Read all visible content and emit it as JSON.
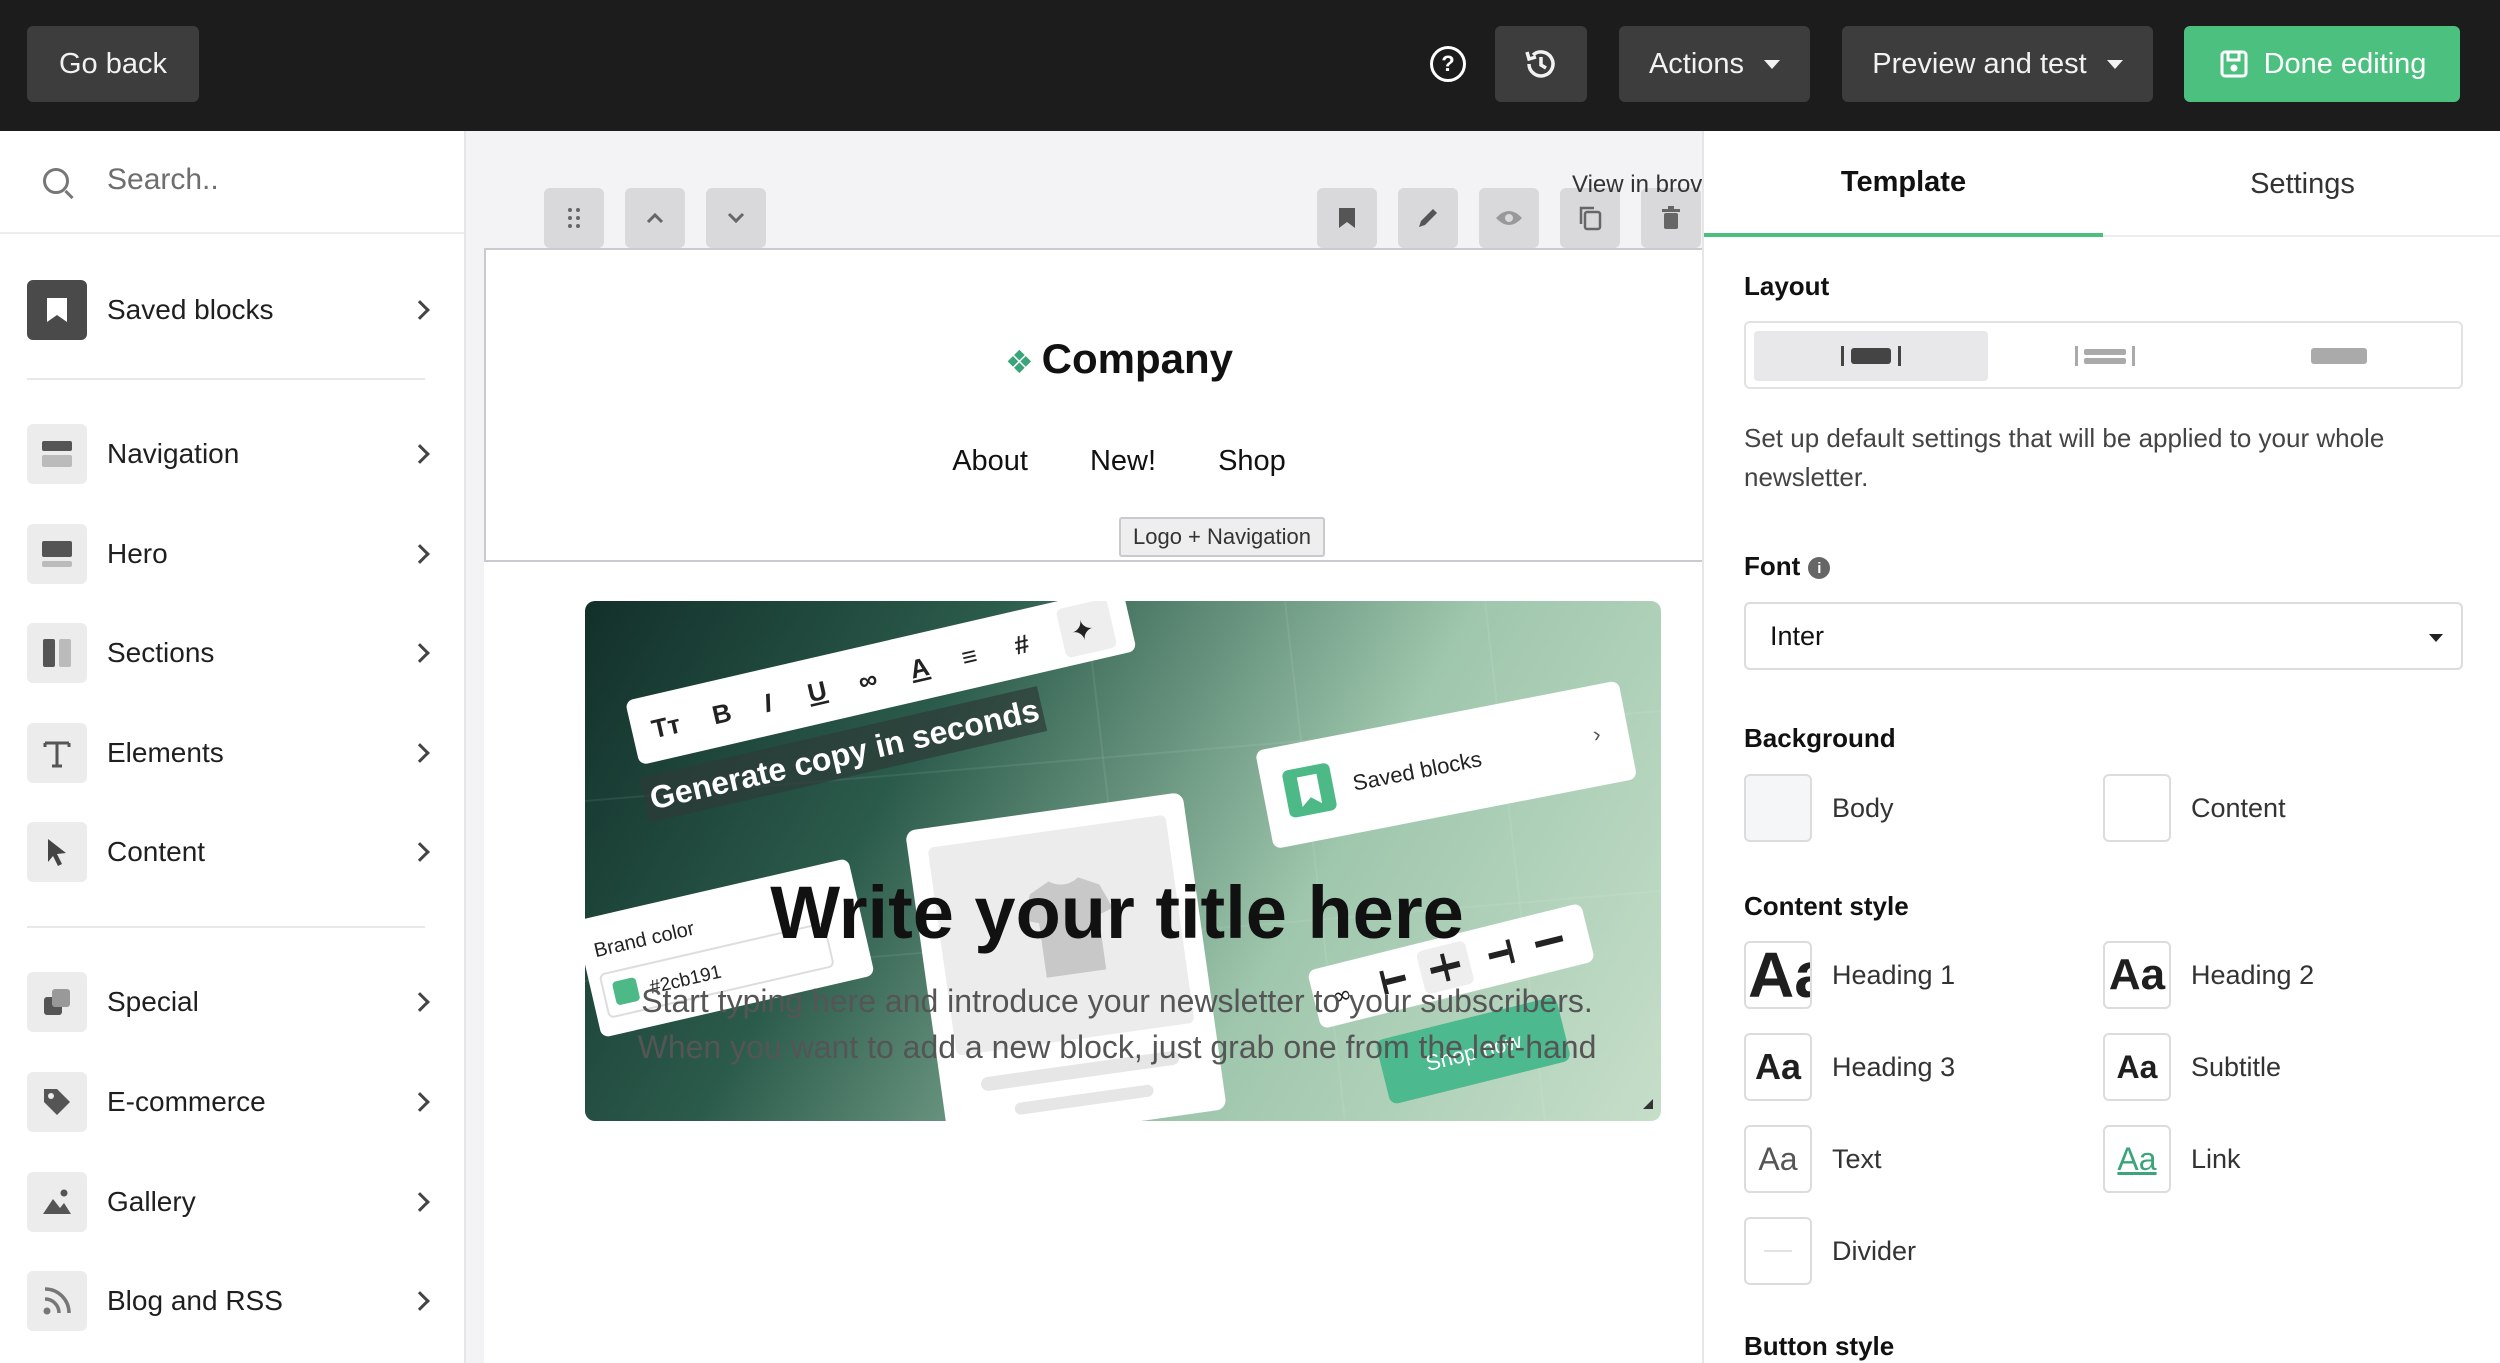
{
  "topbar": {
    "go_back": "Go back",
    "actions": "Actions",
    "preview": "Preview and test",
    "done": "Done editing"
  },
  "sidebar": {
    "search_placeholder": "Search..",
    "items": [
      {
        "label": "Saved blocks",
        "icon": "bookmark-icon"
      },
      {
        "label": "Navigation",
        "icon": "navigation-icon"
      },
      {
        "label": "Hero",
        "icon": "hero-icon"
      },
      {
        "label": "Sections",
        "icon": "sections-icon"
      },
      {
        "label": "Elements",
        "icon": "text-icon"
      },
      {
        "label": "Content",
        "icon": "cursor-icon"
      },
      {
        "label": "Special",
        "icon": "special-icon"
      },
      {
        "label": "E-commerce",
        "icon": "tag-icon"
      },
      {
        "label": "Gallery",
        "icon": "image-icon"
      },
      {
        "label": "Blog and RSS",
        "icon": "rss-icon"
      }
    ]
  },
  "canvas": {
    "view_in_browser": "View in brov",
    "company": "Company",
    "nav": [
      "About",
      "New!",
      "Shop"
    ],
    "block_label": "Logo + Navigation",
    "hero": {
      "generate": "Generate copy in seconds",
      "saved_blocks": "Saved blocks",
      "brand_color_label": "Brand color",
      "brand_color_value": "#2cb191",
      "shop_now": "Shop now"
    },
    "title": "Write your title here",
    "body": "Start typing here and introduce your newsletter to your subscribers.",
    "body2": "When you want to add a new block, just grab one from the left-hand"
  },
  "panel": {
    "tab_template": "Template",
    "tab_settings": "Settings",
    "layout_heading": "Layout",
    "layout_desc": "Set up default settings that will be applied to your whole newsletter.",
    "font_heading": "Font",
    "font_value": "Inter",
    "background_heading": "Background",
    "bg_body": "Body",
    "bg_content": "Content",
    "content_style_heading": "Content style",
    "styles": {
      "h1": "Heading 1",
      "h2": "Heading 2",
      "h3": "Heading 3",
      "subtitle": "Subtitle",
      "text": "Text",
      "link": "Link",
      "divider": "Divider"
    },
    "sample": "Aa",
    "button_style_heading": "Button style"
  },
  "colors": {
    "accent": "#4cc17f",
    "topbar": "#1c1c1c",
    "brand": "#2cb191"
  }
}
